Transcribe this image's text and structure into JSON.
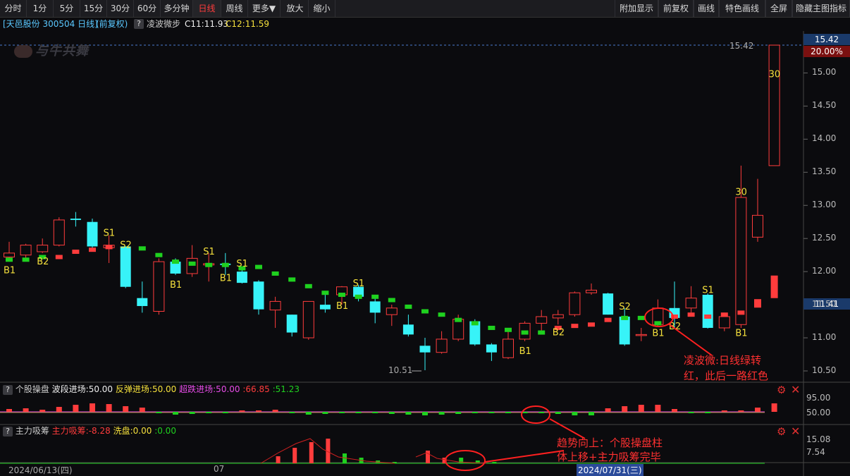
{
  "toolbar": {
    "left": [
      "分时",
      "1分",
      "5分",
      "15分",
      "30分",
      "60分",
      "多分钟",
      "日线",
      "周线",
      "更多▼",
      "放大",
      "缩小"
    ],
    "right": [
      "附加显示",
      "前复权",
      "画线",
      "特色画线",
      "全屏",
      "隐藏主图指标"
    ],
    "active": "日线"
  },
  "info": {
    "stock": "[天邑股份 300504 日线]",
    "adj": "(前复权)",
    "indicator": "凌波微步",
    "c11": "C11:11.93",
    "c12": "C12:11.59",
    "help": "?"
  },
  "watermark": "与牛共舞",
  "price_axis": {
    "ticks": [
      "15.00",
      "14.50",
      "14.00",
      "13.50",
      "13.00",
      "12.50",
      "12.00",
      "11.50",
      "11.00",
      "10.50"
    ],
    "top_price": "15.42",
    "top_pct": "20.00%",
    "current": "11.41",
    "high_label": "15.42",
    "low_label": "10.51"
  },
  "signals": {
    "B1": "B1",
    "B2": "B2",
    "S1": "S1",
    "S2": "S2",
    "n30": "30"
  },
  "panel1": {
    "name": "个股操盘",
    "l1": "波段进场:50.00",
    "l2": "反弹进场:50.00",
    "l3": "超跌进场:50.00",
    "v1": ":66.85",
    "v2": ":51.23",
    "axis": [
      "95.00",
      "50.00"
    ]
  },
  "panel2": {
    "name": "主力吸筹",
    "l1": "主力吸筹:-8.28",
    "l2": "洗盘:0.00",
    "l3": ":0.00",
    "axis": [
      "15.08",
      "7.54"
    ]
  },
  "dates": [
    "2024/06/13(四)",
    "07",
    "2024/07/31(三)"
  ],
  "annotations": {
    "a1_line1": "凌波微:日线绿转",
    "a1_line2": "红，此后一路红色",
    "a2_line1": "趋势向上：个股操盘柱",
    "a2_line2": "体上移+主力吸筹完毕"
  },
  "colors": {
    "up": "#ff3c3c",
    "down": "#37f3f8",
    "signal": "#f5e03c",
    "green": "#1fd11f",
    "magenta": "#e84ce8"
  },
  "chart_data": {
    "type": "candlestick",
    "ylim": [
      10.4,
      15.5
    ],
    "candles": [
      {
        "o": 12.22,
        "h": 12.45,
        "l": 12.18,
        "c": 12.28
      },
      {
        "o": 12.25,
        "h": 12.42,
        "l": 12.2,
        "c": 12.4
      },
      {
        "o": 12.3,
        "h": 12.5,
        "l": 12.28,
        "c": 12.4
      },
      {
        "o": 12.4,
        "h": 12.82,
        "l": 12.38,
        "c": 12.78
      },
      {
        "o": 12.8,
        "h": 12.9,
        "l": 12.68,
        "c": 12.78
      },
      {
        "o": 12.75,
        "h": 12.8,
        "l": 12.35,
        "c": 12.38
      },
      {
        "o": 12.36,
        "h": 12.55,
        "l": 12.13,
        "c": 12.4
      },
      {
        "o": 12.38,
        "h": 12.38,
        "l": 11.75,
        "c": 11.77
      },
      {
        "o": 11.6,
        "h": 11.85,
        "l": 11.38,
        "c": 11.48
      },
      {
        "o": 11.4,
        "h": 12.2,
        "l": 11.35,
        "c": 12.15
      },
      {
        "o": 12.15,
        "h": 12.2,
        "l": 11.95,
        "c": 11.97
      },
      {
        "o": 11.97,
        "h": 12.4,
        "l": 11.92,
        "c": 12.2
      },
      {
        "o": 12.1,
        "h": 12.28,
        "l": 11.85,
        "c": 12.12
      },
      {
        "o": 12.12,
        "h": 12.28,
        "l": 11.95,
        "c": 12.1
      },
      {
        "o": 12.0,
        "h": 12.05,
        "l": 11.82,
        "c": 11.83
      },
      {
        "o": 11.85,
        "h": 11.87,
        "l": 11.35,
        "c": 11.43
      },
      {
        "o": 11.42,
        "h": 11.62,
        "l": 11.15,
        "c": 11.55
      },
      {
        "o": 11.35,
        "h": 11.35,
        "l": 11.02,
        "c": 11.08
      },
      {
        "o": 11.0,
        "h": 11.55,
        "l": 10.97,
        "c": 11.55
      },
      {
        "o": 11.5,
        "h": 11.65,
        "l": 11.38,
        "c": 11.43
      },
      {
        "o": 11.65,
        "h": 11.78,
        "l": 11.5,
        "c": 11.77
      },
      {
        "o": 11.77,
        "h": 11.8,
        "l": 11.55,
        "c": 11.62
      },
      {
        "o": 11.55,
        "h": 11.65,
        "l": 11.22,
        "c": 11.38
      },
      {
        "o": 11.35,
        "h": 11.5,
        "l": 11.18,
        "c": 11.45
      },
      {
        "o": 11.2,
        "h": 11.35,
        "l": 11.02,
        "c": 11.05
      },
      {
        "o": 10.88,
        "h": 11.0,
        "l": 10.51,
        "c": 10.78
      },
      {
        "o": 10.78,
        "h": 11.1,
        "l": 10.76,
        "c": 10.98
      },
      {
        "o": 10.98,
        "h": 11.35,
        "l": 10.95,
        "c": 11.28
      },
      {
        "o": 11.25,
        "h": 11.28,
        "l": 10.88,
        "c": 10.9
      },
      {
        "o": 10.9,
        "h": 10.92,
        "l": 10.65,
        "c": 10.78
      },
      {
        "o": 10.7,
        "h": 11.1,
        "l": 10.68,
        "c": 10.98
      },
      {
        "o": 10.98,
        "h": 11.25,
        "l": 10.95,
        "c": 11.22
      },
      {
        "o": 11.22,
        "h": 11.42,
        "l": 11.1,
        "c": 11.32
      },
      {
        "o": 11.3,
        "h": 11.42,
        "l": 11.2,
        "c": 11.35
      },
      {
        "o": 11.35,
        "h": 11.7,
        "l": 11.32,
        "c": 11.68
      },
      {
        "o": 11.68,
        "h": 11.82,
        "l": 11.65,
        "c": 11.72
      },
      {
        "o": 11.67,
        "h": 11.68,
        "l": 11.35,
        "c": 11.35
      },
      {
        "o": 11.32,
        "h": 11.45,
        "l": 10.88,
        "c": 10.9
      },
      {
        "o": 11.05,
        "h": 11.15,
        "l": 10.95,
        "c": 11.05
      },
      {
        "o": 11.2,
        "h": 11.58,
        "l": 11.18,
        "c": 11.45
      },
      {
        "o": 11.45,
        "h": 11.85,
        "l": 11.15,
        "c": 11.3
      },
      {
        "o": 11.45,
        "h": 11.78,
        "l": 11.38,
        "c": 11.6
      },
      {
        "o": 11.65,
        "h": 11.67,
        "l": 11.14,
        "c": 11.15
      },
      {
        "o": 11.15,
        "h": 11.38,
        "l": 11.1,
        "c": 11.32
      },
      {
        "o": 11.2,
        "h": 13.6,
        "l": 11.15,
        "c": 13.12
      },
      {
        "o": 12.52,
        "h": 13.4,
        "l": 12.45,
        "c": 12.85
      },
      {
        "o": 13.6,
        "h": 15.42,
        "l": 13.6,
        "c": 15.42
      }
    ]
  }
}
